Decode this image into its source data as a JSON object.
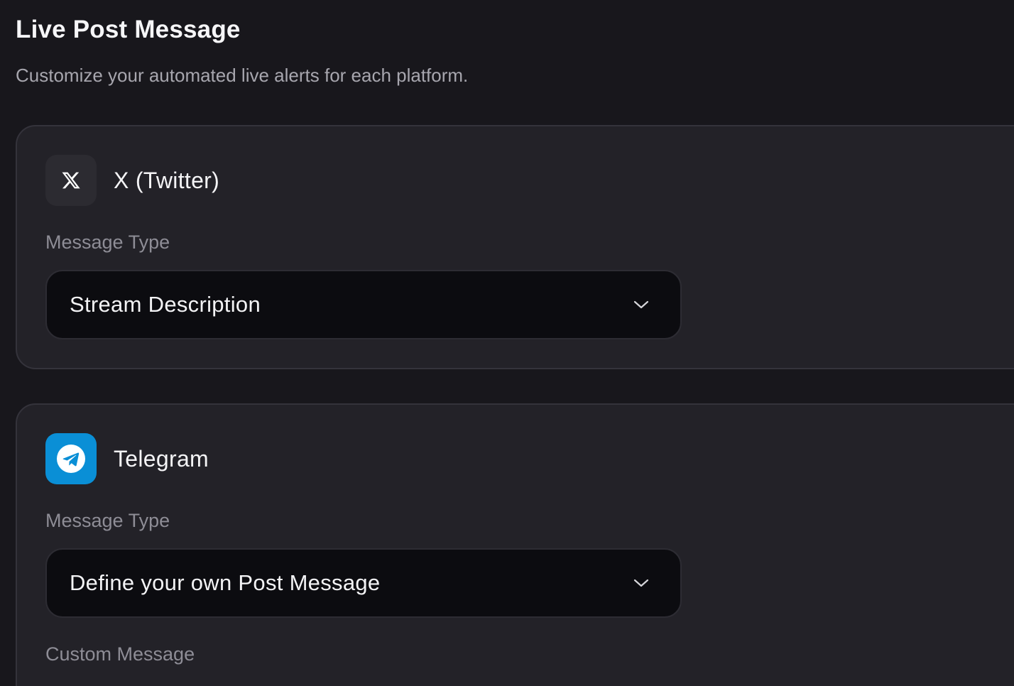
{
  "page": {
    "title": "Live Post Message",
    "subtitle": "Customize your automated live alerts for each platform."
  },
  "platforms": [
    {
      "name": "X (Twitter)",
      "icon": "x-logo-icon",
      "icon_bg": "#2c2b31",
      "message_type_label": "Message Type",
      "message_type_value": "Stream Description"
    },
    {
      "name": "Telegram",
      "icon": "telegram-logo-icon",
      "icon_bg": "#0a8fd6",
      "message_type_label": "Message Type",
      "message_type_value": "Define your own Post Message",
      "custom_message_label": "Custom Message"
    }
  ],
  "colors": {
    "background": "#18171c",
    "card": "#232228",
    "select": "#0c0c10",
    "telegram_blue": "#0a8fd6"
  }
}
